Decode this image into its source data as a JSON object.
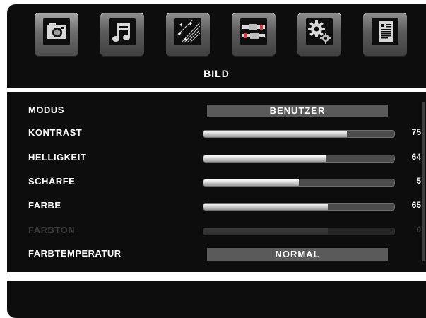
{
  "menu": {
    "title": "BILD",
    "tabs": [
      {
        "name": "picture",
        "icon": "camera-icon",
        "active": true
      },
      {
        "name": "sound",
        "icon": "music-note-icon",
        "active": false
      },
      {
        "name": "channel",
        "icon": "channel-stars-icon",
        "active": false
      },
      {
        "name": "source",
        "icon": "connector-cable-icon",
        "active": false
      },
      {
        "name": "setup",
        "icon": "gear-icon",
        "active": false
      },
      {
        "name": "info",
        "icon": "document-icon",
        "active": false
      }
    ]
  },
  "settings": [
    {
      "label": "MODUS",
      "type": "select",
      "value": "BENUTZER"
    },
    {
      "label": "KONTRAST",
      "type": "slider",
      "value": "75",
      "level": 0.75
    },
    {
      "label": "HELLIGKEIT",
      "type": "slider",
      "value": "64",
      "level": 0.64
    },
    {
      "label": "SCHÄRFE",
      "type": "slider",
      "value": "5",
      "level": 0.5
    },
    {
      "label": "FARBE",
      "type": "slider",
      "value": "65",
      "level": 0.65
    },
    {
      "label": "FARBTON",
      "type": "slider",
      "value": "0",
      "level": 0.65,
      "disabled": true
    },
    {
      "label": "FARBTEMPERATUR",
      "type": "select",
      "value": "NORMAL"
    }
  ],
  "colors": {
    "panel": "#0d0d0d",
    "select_box": "#5a5a5a",
    "disabled_text": "#3a3a3a"
  }
}
